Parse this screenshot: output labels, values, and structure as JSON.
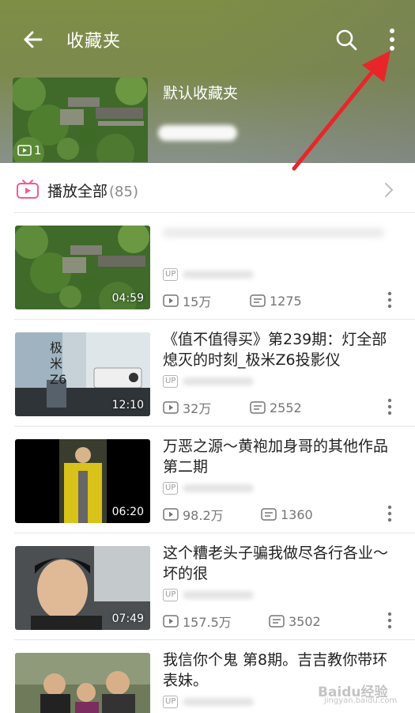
{
  "header": {
    "title": "收藏夹",
    "folder": {
      "name": "默认收藏夹",
      "video_count": "1"
    }
  },
  "play_all": {
    "label": "播放全部",
    "count": "(85)"
  },
  "videos": [
    {
      "title": "",
      "duration": "04:59",
      "up_name": "",
      "views": "15万",
      "danmaku": "1275",
      "thumb": "aerial-garden"
    },
    {
      "title": "《值不值得买》第239期：灯全部熄灭的时刻_极米Z6投影仪",
      "duration": "12:10",
      "up_name": "",
      "views": "32万",
      "danmaku": "2552",
      "thumb_text": [
        "极",
        "米",
        "Z6"
      ]
    },
    {
      "title": "万恶之源～黄袍加身哥的其他作品第二期",
      "duration": "06:20",
      "up_name": "",
      "views": "98.2万",
      "danmaku": "1360",
      "thumb": "man-yellow-coat"
    },
    {
      "title": "这个糟老头子骗我做尽各行各业～坏的很",
      "duration": "07:49",
      "up_name": "",
      "views": "157.5万",
      "danmaku": "3502",
      "thumb": "man-in-car"
    },
    {
      "title": "我信你个鬼 第8期。吉吉教你带环表妹。",
      "duration": "",
      "up_name": "",
      "views": "",
      "danmaku": "",
      "thumb": "group-of-three"
    }
  ],
  "badge_up": "UP",
  "colors": {
    "header": "#7e8e45",
    "annotation_arrow": "#e8262a",
    "playall_icon": "#f45a8d",
    "text_secondary": "#757575"
  },
  "watermark": {
    "brand": "Baidu经验",
    "url": "jingyan.baidu.com"
  }
}
